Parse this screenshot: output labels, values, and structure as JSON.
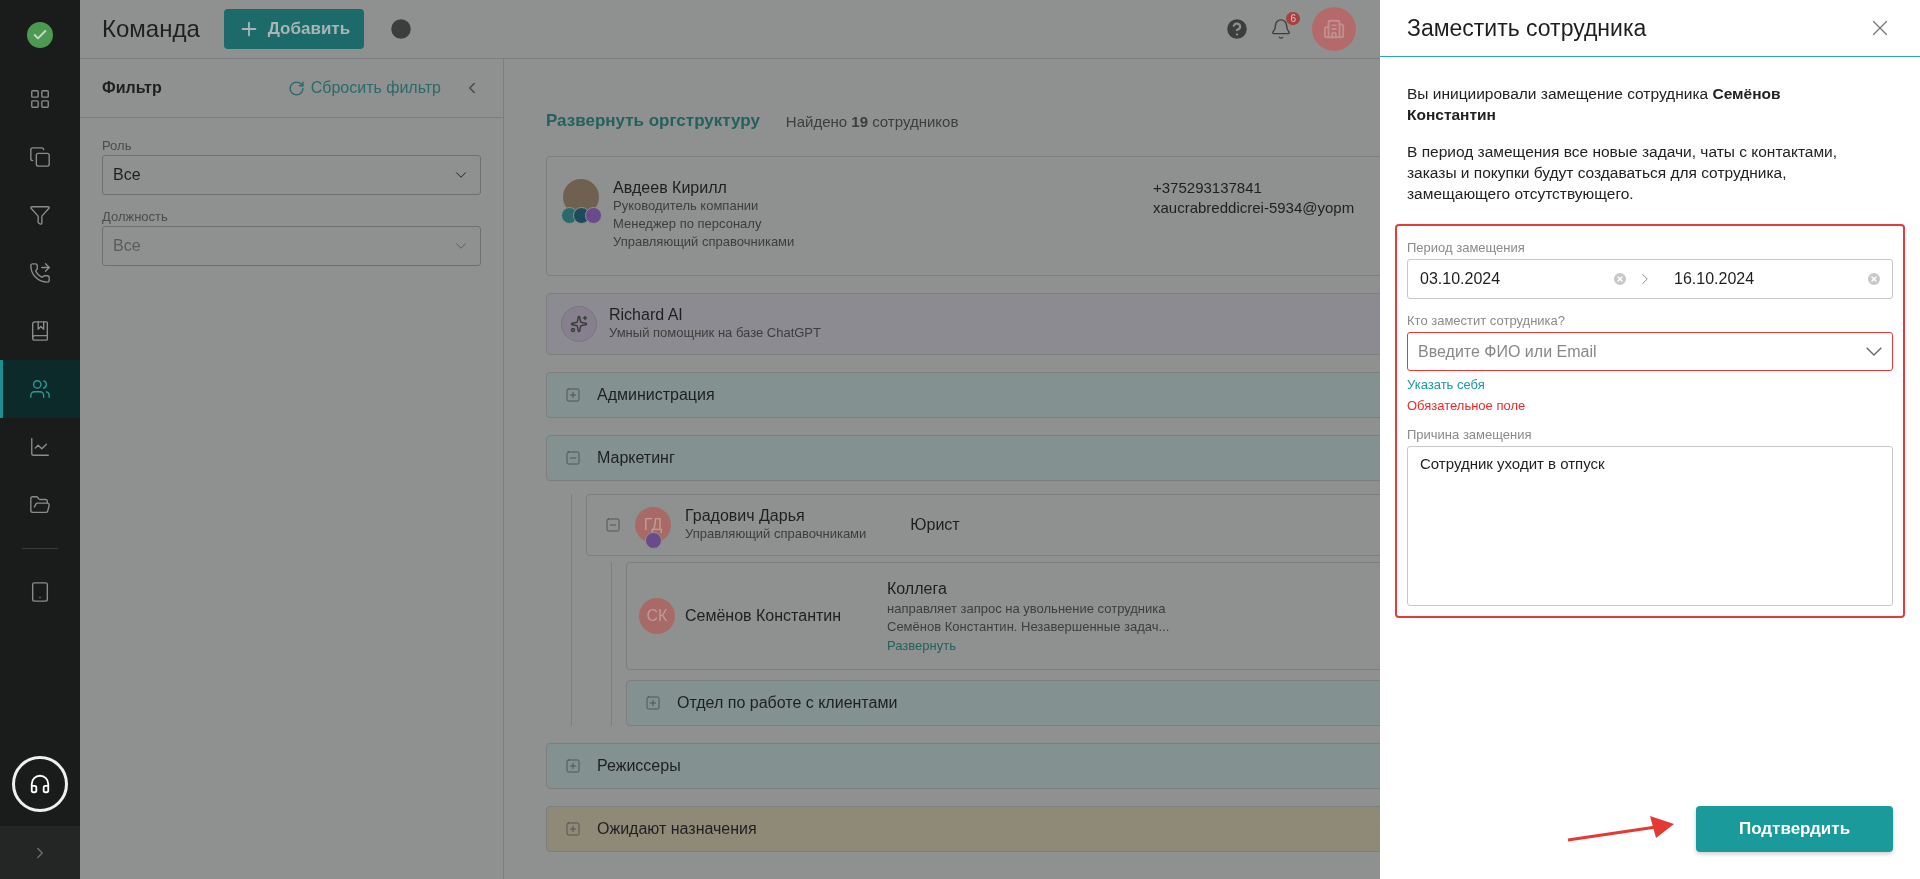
{
  "sidebar": {
    "nav_items": [
      {
        "selected": false
      },
      {
        "selected": false
      },
      {
        "selected": false
      },
      {
        "selected": false
      },
      {
        "selected": false
      },
      {
        "selected": true
      },
      {
        "selected": false
      },
      {
        "selected": false
      },
      {
        "selected": false
      }
    ]
  },
  "header": {
    "title": "Команда",
    "add_button": "Добавить",
    "notification_count": "6"
  },
  "filter": {
    "title": "Фильтр",
    "reset": "Сбросить фильтр",
    "fields": [
      {
        "label": "Роль",
        "value": "Все"
      },
      {
        "label": "Должность",
        "value": "Все"
      }
    ]
  },
  "summary": {
    "expand_link": "Развернуть оргструктуру",
    "found": "Найдено **19** сотрудников"
  },
  "org_items": [
    {
      "kind": "employee",
      "name": "Авдеев Кирилл",
      "roles": [
        "Руководитель компании",
        "Менеджер по персоналу",
        "Управляющий справочниками"
      ],
      "phone": "+375293137841",
      "email": "xaucrabreddicrei-5934@yopm"
    },
    {
      "kind": "assistant",
      "name": "Richard AI",
      "description": "Умный помощник на базе ChatGPT"
    },
    {
      "kind": "department",
      "name": "Администрация",
      "expanded": false,
      "color": "#839191"
    },
    {
      "kind": "department",
      "name": "Маркетинг",
      "expanded": true,
      "color": "#839191",
      "children": [
        {
          "kind": "manager",
          "initials": "ГД",
          "name": "Градович Дарья",
          "role": "Управляющий справочниками",
          "position": "Юрист",
          "expanded": true,
          "children": [
            {
              "kind": "request",
              "initials": "СК",
              "name": "Семёнов Константин",
              "note_title": "Коллега",
              "note_text": "направляет запрос на увольнение сотрудника Семёнов Константин. Незавершенные задач...",
              "expand_link": "Развернуть"
            },
            {
              "kind": "department",
              "name": "Отдел по работе с клиентами",
              "expanded": false,
              "color": "#839191"
            }
          ]
        }
      ]
    },
    {
      "kind": "department",
      "name": "Режиссеры",
      "expanded": false,
      "color": "#839191"
    },
    {
      "kind": "department",
      "name": "Ожидают назначения",
      "expanded": false,
      "color": "#8f8a78"
    }
  ],
  "drawer": {
    "title": "Заместить сотрудника",
    "intro": "Вы инициировали замещение сотрудника **Семёнов Константин**",
    "info": "В период замещения все новые задачи, чаты с контактами, заказы и покупки будут создаваться для сотрудника, замещающего отсутствующего.",
    "period_label": "Период замещения",
    "date_from": "03.10.2024",
    "date_to": "16.10.2024",
    "substitute_label": "Кто заместит сотрудника?",
    "substitute_placeholder": "Введите ФИО или Email",
    "self_link": "Указать себя",
    "error": "Обязательное поле",
    "reason_label": "Причина замещения",
    "reason_value": "Сотрудник уходит в отпуск",
    "confirm_button": "Подтвердить"
  }
}
